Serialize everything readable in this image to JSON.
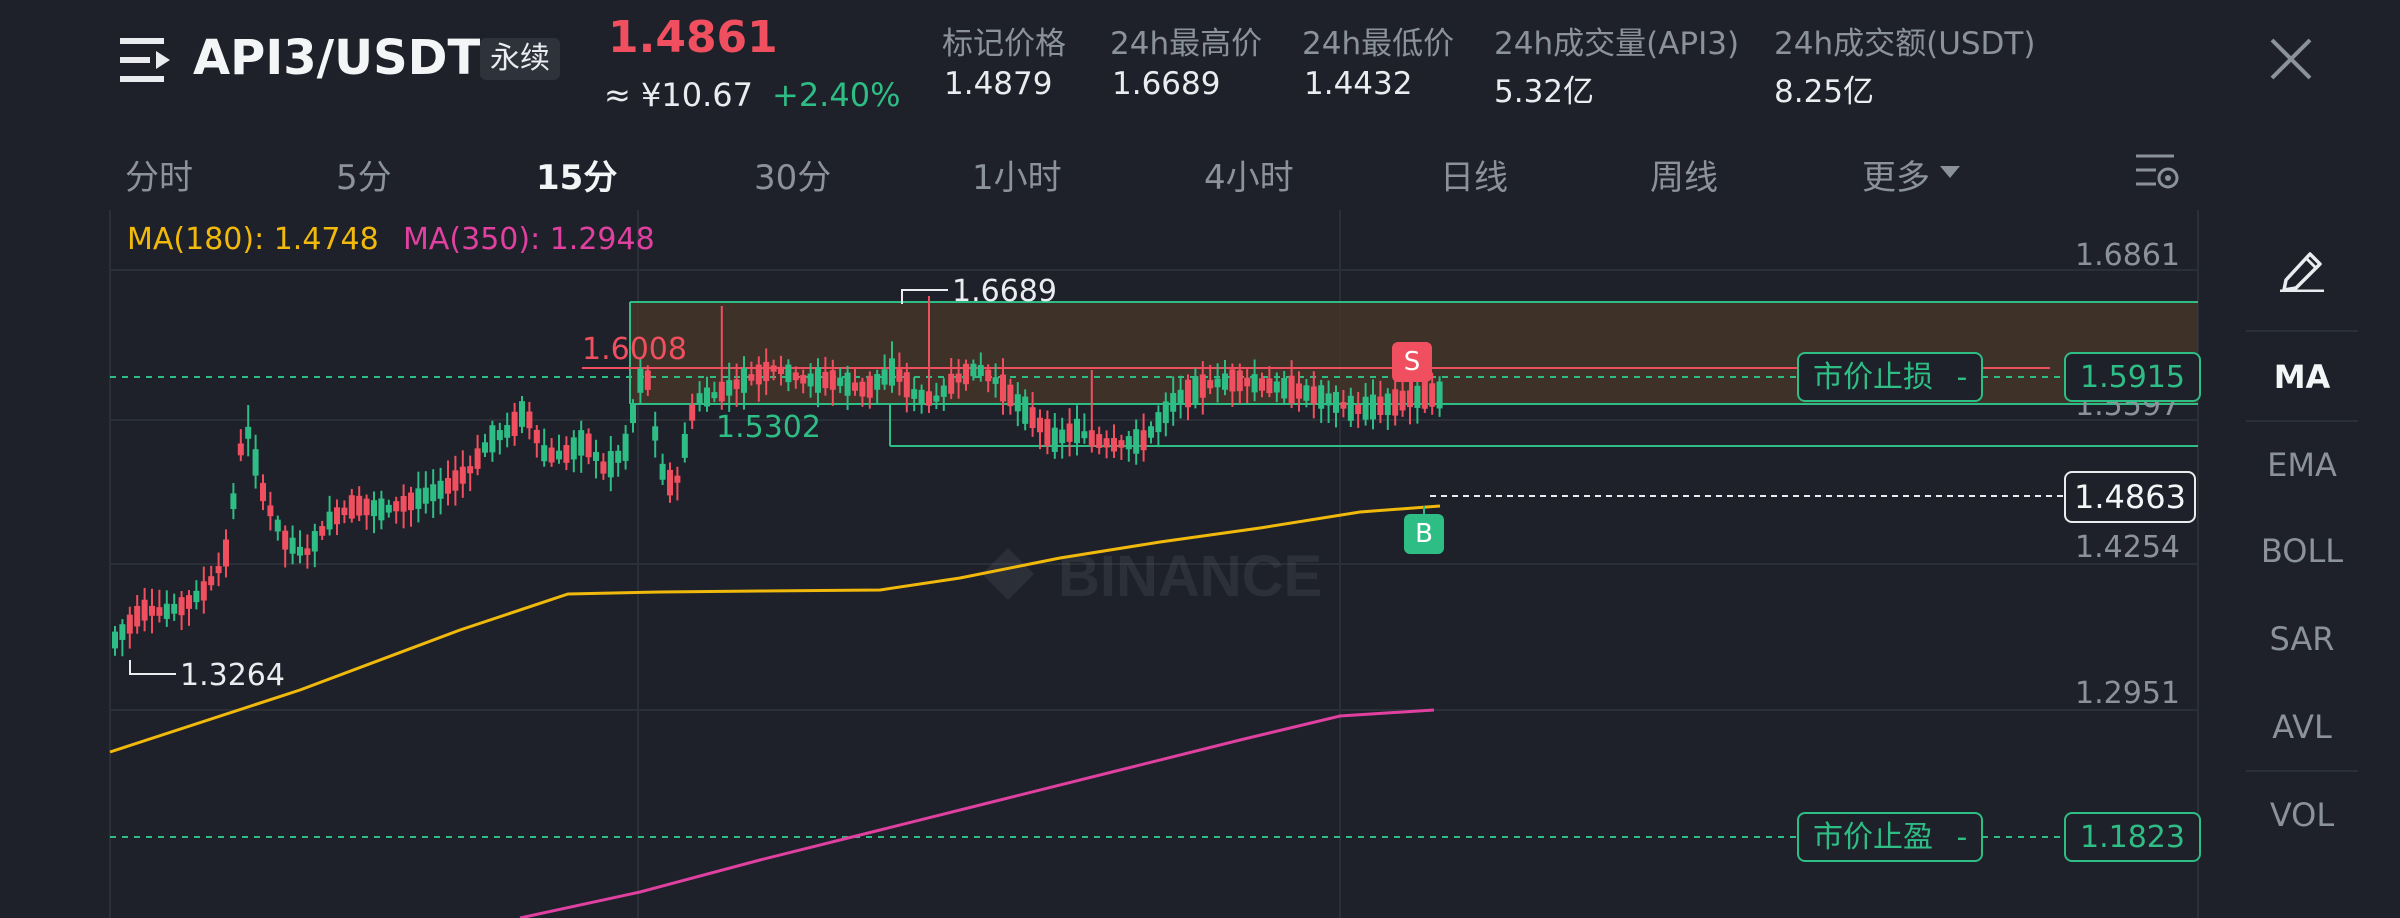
{
  "header": {
    "symbol": "API3/USDT",
    "contract_type": "永续",
    "last_price": "1.4861",
    "cny_price": "≈ ¥10.67",
    "change_pct": "+2.40%",
    "stats": [
      {
        "label": "标记价格",
        "value": "1.4879"
      },
      {
        "label": "24h最高价",
        "value": "1.6689"
      },
      {
        "label": "24h最低价",
        "value": "1.4432"
      },
      {
        "label": "24h成交量(API3)",
        "value": "5.32亿"
      },
      {
        "label": "24h成交额(USDT)",
        "value": "8.25亿"
      }
    ]
  },
  "intervals": [
    "分时",
    "5分",
    "15分",
    "30分",
    "1小时",
    "4小时",
    "日线",
    "周线",
    "更多"
  ],
  "active_interval": "15分",
  "ma_legend": {
    "ma180": "MA(180): 1.4748",
    "ma350": "MA(350): 1.2948",
    "ma180_color": "#f0b90b",
    "ma350_color": "#e040a0"
  },
  "indicators": [
    "MA",
    "EMA",
    "BOLL",
    "SAR",
    "AVL",
    "VOL"
  ],
  "active_indicator": "MA",
  "price_axis": [
    "1.6861",
    "1.5597",
    "1.4254",
    "1.2951"
  ],
  "orders": {
    "stop_loss_label": "市价止损",
    "stop_loss_price": "1.5915",
    "take_profit_label": "市价止盈",
    "take_profit_price": "1.1823",
    "dash": "-"
  },
  "current_price_tag": "1.4863",
  "chart_labels": {
    "high": "1.6689",
    "low": "1.3264",
    "red_level": "1.6008",
    "green_level": "1.5302",
    "sell_marker": "S",
    "buy_marker": "B",
    "watermark": "BINANCE"
  },
  "colors": {
    "up": "#2ebd85",
    "down": "#f04f5f",
    "background": "#1e2129"
  }
}
